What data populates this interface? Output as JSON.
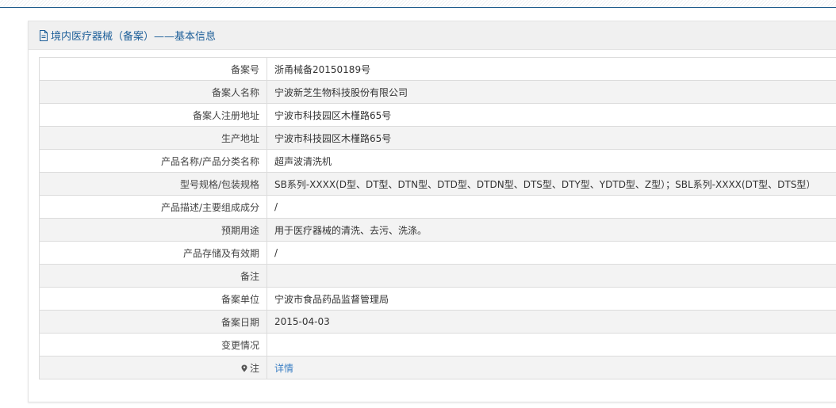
{
  "panel": {
    "title": "境内医疗器械（备案）——基本信息"
  },
  "rows": [
    {
      "label": "备案号",
      "value": "浙甬械备20150189号"
    },
    {
      "label": "备案人名称",
      "value": "宁波新芝生物科技股份有限公司"
    },
    {
      "label": "备案人注册地址",
      "value": "宁波市科技园区木槿路65号"
    },
    {
      "label": "生产地址",
      "value": "宁波市科技园区木槿路65号"
    },
    {
      "label": "产品名称/产品分类名称",
      "value": "超声波清洗机"
    },
    {
      "label": "型号规格/包装规格",
      "value": "SB系列-XXXX(D型、DT型、DTN型、DTD型、DTDN型、DTS型、DTY型、YDTD型、Z型）；SBL系列-XXXX(DT型、DTS型）"
    },
    {
      "label": "产品描述/主要组成成分",
      "value": "/"
    },
    {
      "label": "预期用途",
      "value": "用于医疗器械的清洗、去污、洗涤。"
    },
    {
      "label": "产品存储及有效期",
      "value": "/"
    },
    {
      "label": "备注",
      "value": ""
    },
    {
      "label": "备案单位",
      "value": "宁波市食品药品监督管理局"
    },
    {
      "label": "备案日期",
      "value": "2015-04-03"
    },
    {
      "label": "变更情况",
      "value": ""
    }
  ],
  "note_row": {
    "label": "注",
    "link_text": "详情"
  },
  "icons": {
    "header": "document-icon",
    "note": "map-pin-icon"
  },
  "colors": {
    "title": "#1e5f99",
    "link": "#3b7fc4",
    "rule": "#1f5c8c"
  }
}
